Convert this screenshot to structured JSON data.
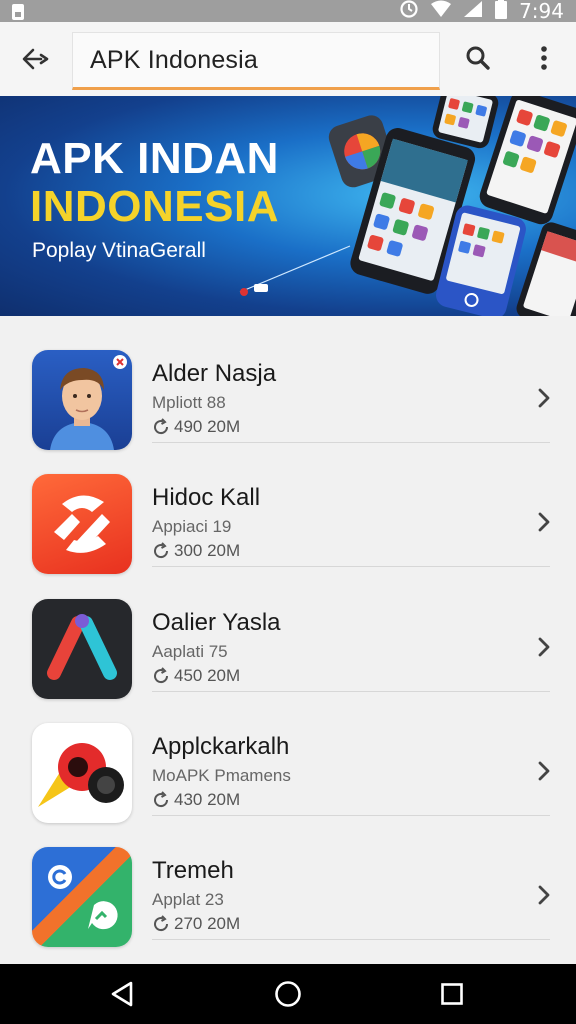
{
  "status_bar": {
    "time": "7:94"
  },
  "search": {
    "query": "APK Indonesia"
  },
  "banner": {
    "title_line1": "APK INDAN",
    "title_line2": "INDONESIA",
    "subtitle": "Poplay VtinaGerall"
  },
  "apps": [
    {
      "name": "Alder Nasja",
      "subtitle": "Mpliott 88",
      "stats": "490 20M"
    },
    {
      "name": "Hidoc Kall",
      "subtitle": "Appiaci 19",
      "stats": "300 20M"
    },
    {
      "name": "Oalier Yasla",
      "subtitle": "Aaplati 75",
      "stats": "450 20M"
    },
    {
      "name": "Applckarkalh",
      "subtitle": "MoAPK Pmamens",
      "stats": "430 20M"
    },
    {
      "name": "Tremeh",
      "subtitle": "Applat 23",
      "stats": "270 20M"
    }
  ],
  "colors": {
    "accent": "#f0a04b",
    "banner_yellow": "#f5d32a"
  }
}
